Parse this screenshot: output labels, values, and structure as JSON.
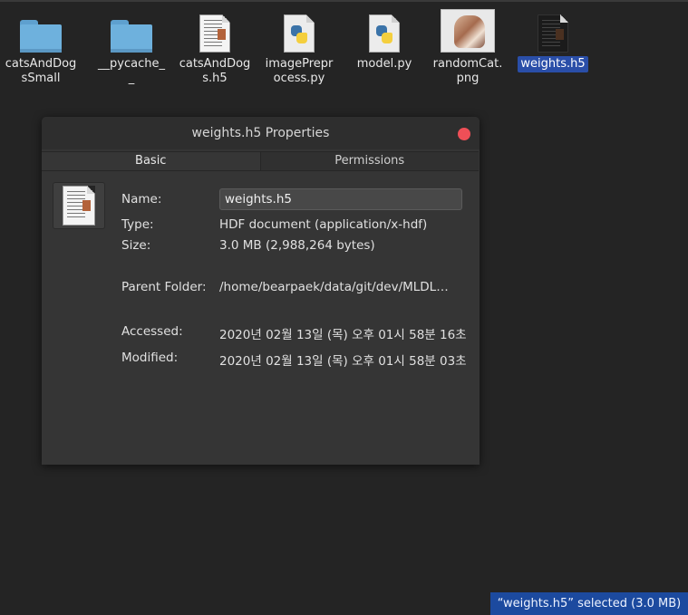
{
  "files": [
    {
      "name": "catsAndDogsSmall",
      "icon": "folder-icon"
    },
    {
      "name": "__pycache__",
      "icon": "folder-icon"
    },
    {
      "name": "catsAndDogs.h5",
      "icon": "document-icon"
    },
    {
      "name": "imagePreprocess.py",
      "icon": "python-file-icon"
    },
    {
      "name": "model.py",
      "icon": "python-file-icon"
    },
    {
      "name": "randomCat.png",
      "icon": "image-thumbnail"
    },
    {
      "name": "weights.h5",
      "icon": "document-icon",
      "selected": true
    }
  ],
  "dialog": {
    "title": "weights.h5 Properties",
    "tabs": [
      "Basic",
      "Permissions"
    ],
    "labels": {
      "name": "Name:",
      "type": "Type:",
      "size": "Size:",
      "parent": "Parent Folder:",
      "accessed": "Accessed:",
      "modified": "Modified:"
    },
    "values": {
      "name": "weights.h5",
      "type": "HDF document (application/x-hdf)",
      "size": "3.0 MB (2,988,264 bytes)",
      "parent": "/home/bearpaek/data/git/dev/MLDL…",
      "accessed": "2020년 02월 13일 (목) 오후 01시 58분 16초",
      "modified": "2020년 02월 13일 (목) 오후 01시 58분 03초"
    }
  },
  "status": "“weights.h5” selected  (3.0 MB)",
  "colors": {
    "selection": "#2a4ea8",
    "status_bg": "#1c4a9f",
    "close": "#ef4f57"
  }
}
